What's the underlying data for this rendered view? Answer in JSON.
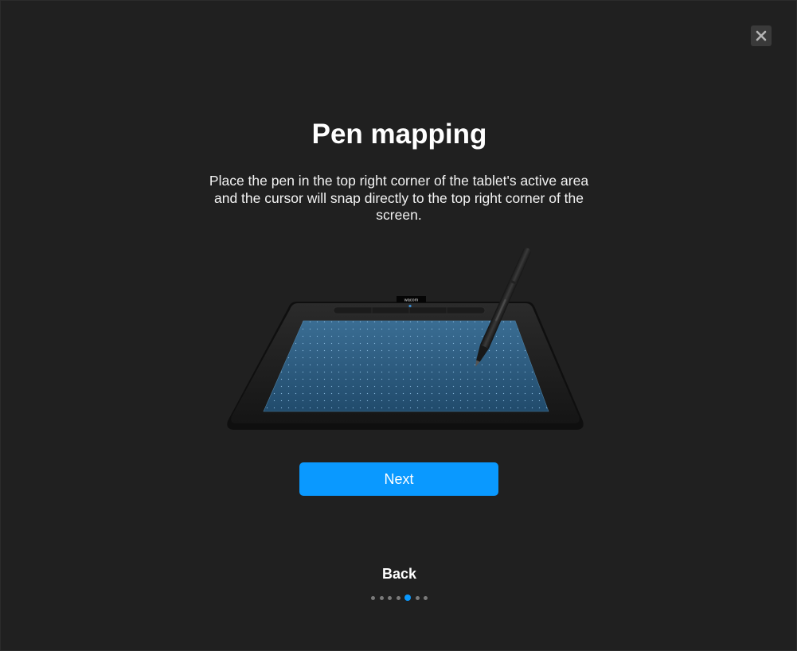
{
  "dialog": {
    "title": "Pen mapping",
    "description": "Place the pen in the top right corner of the tablet's active area and the cursor will snap directly to the top right corner of the screen.",
    "next_label": "Next",
    "back_label": "Back",
    "close_icon": "close-icon",
    "tablet_brand": "wacom"
  },
  "progress": {
    "total_steps": 7,
    "current_step": 5
  },
  "colors": {
    "background": "#202020",
    "accent": "#0a99ff",
    "text": "#ffffff",
    "dot_inactive": "#7a7a7a"
  }
}
